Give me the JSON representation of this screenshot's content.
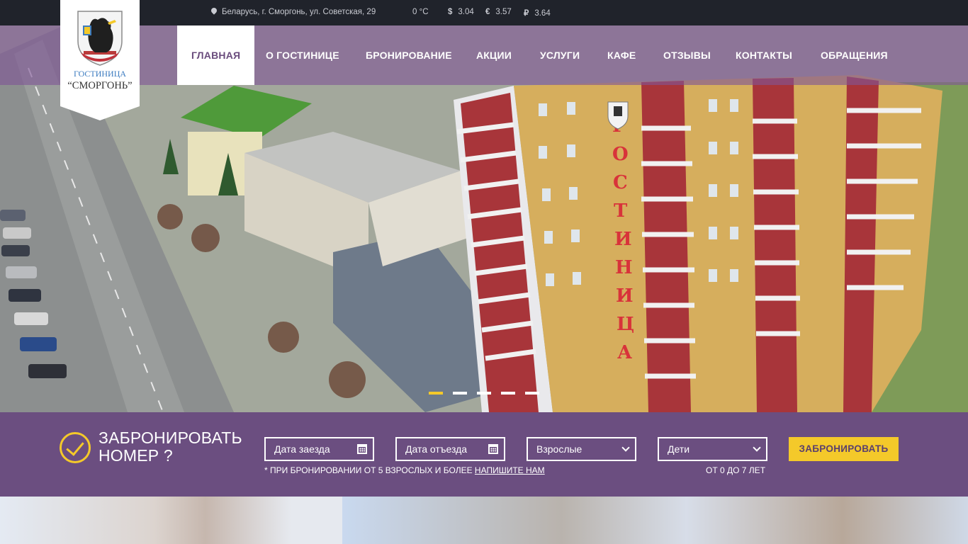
{
  "topbar": {
    "address": "Беларусь, г. Сморгонь, ул. Советская, 29",
    "temperature": "0 °C",
    "rates": [
      {
        "symbol": "$",
        "value": "3.04"
      },
      {
        "symbol": "€",
        "value": "3.57"
      },
      {
        "symbol": "₽",
        "value": "3.64"
      }
    ]
  },
  "logo": {
    "line1": "ГОСТИНИЦА",
    "line2": "“СМОРГОНЬ”"
  },
  "nav": {
    "items": [
      {
        "label": "ГЛАВНАЯ",
        "active": true
      },
      {
        "label": "О ГОСТИНИЦЕ"
      },
      {
        "label": "БРОНИРОВАНИЕ"
      },
      {
        "label": "АКЦИИ"
      },
      {
        "label": "УСЛУГИ"
      },
      {
        "label": "КАФЕ"
      },
      {
        "label": "ОТЗЫВЫ"
      },
      {
        "label": "КОНТАКТЫ"
      },
      {
        "label": "ОБРАЩЕНИЯ"
      }
    ]
  },
  "hero": {
    "building_sign": "ГОСТИНИЦА",
    "slides": 5,
    "active_slide": 1
  },
  "booking": {
    "title_line1": "ЗАБРОНИРОВАТЬ",
    "title_line2": "НОМЕР ?",
    "checkin_placeholder": "Дата заезда",
    "checkout_placeholder": "Дата отъезда",
    "adults_label": "Взрослые",
    "children_label": "Дети",
    "submit_label": "ЗАБРОНИРОВАТЬ",
    "note_text": "* ПРИ БРОНИРОВАНИИ ОТ 5 ВЗРОСЛЫХ И БОЛЕЕ ",
    "note_link": "НАПИШИТЕ НАМ",
    "age_note": "ОТ 0 ДО 7 ЛЕТ"
  },
  "colors": {
    "accent": "#f4c92a",
    "brand_purple": "#6b4e80",
    "topbar_bg": "#20232b"
  },
  "icons": [
    "map-pin-icon",
    "dollar-icon",
    "euro-icon",
    "ruble-icon",
    "checkmark-circle-icon",
    "calendar-icon",
    "chevron-down-icon"
  ]
}
